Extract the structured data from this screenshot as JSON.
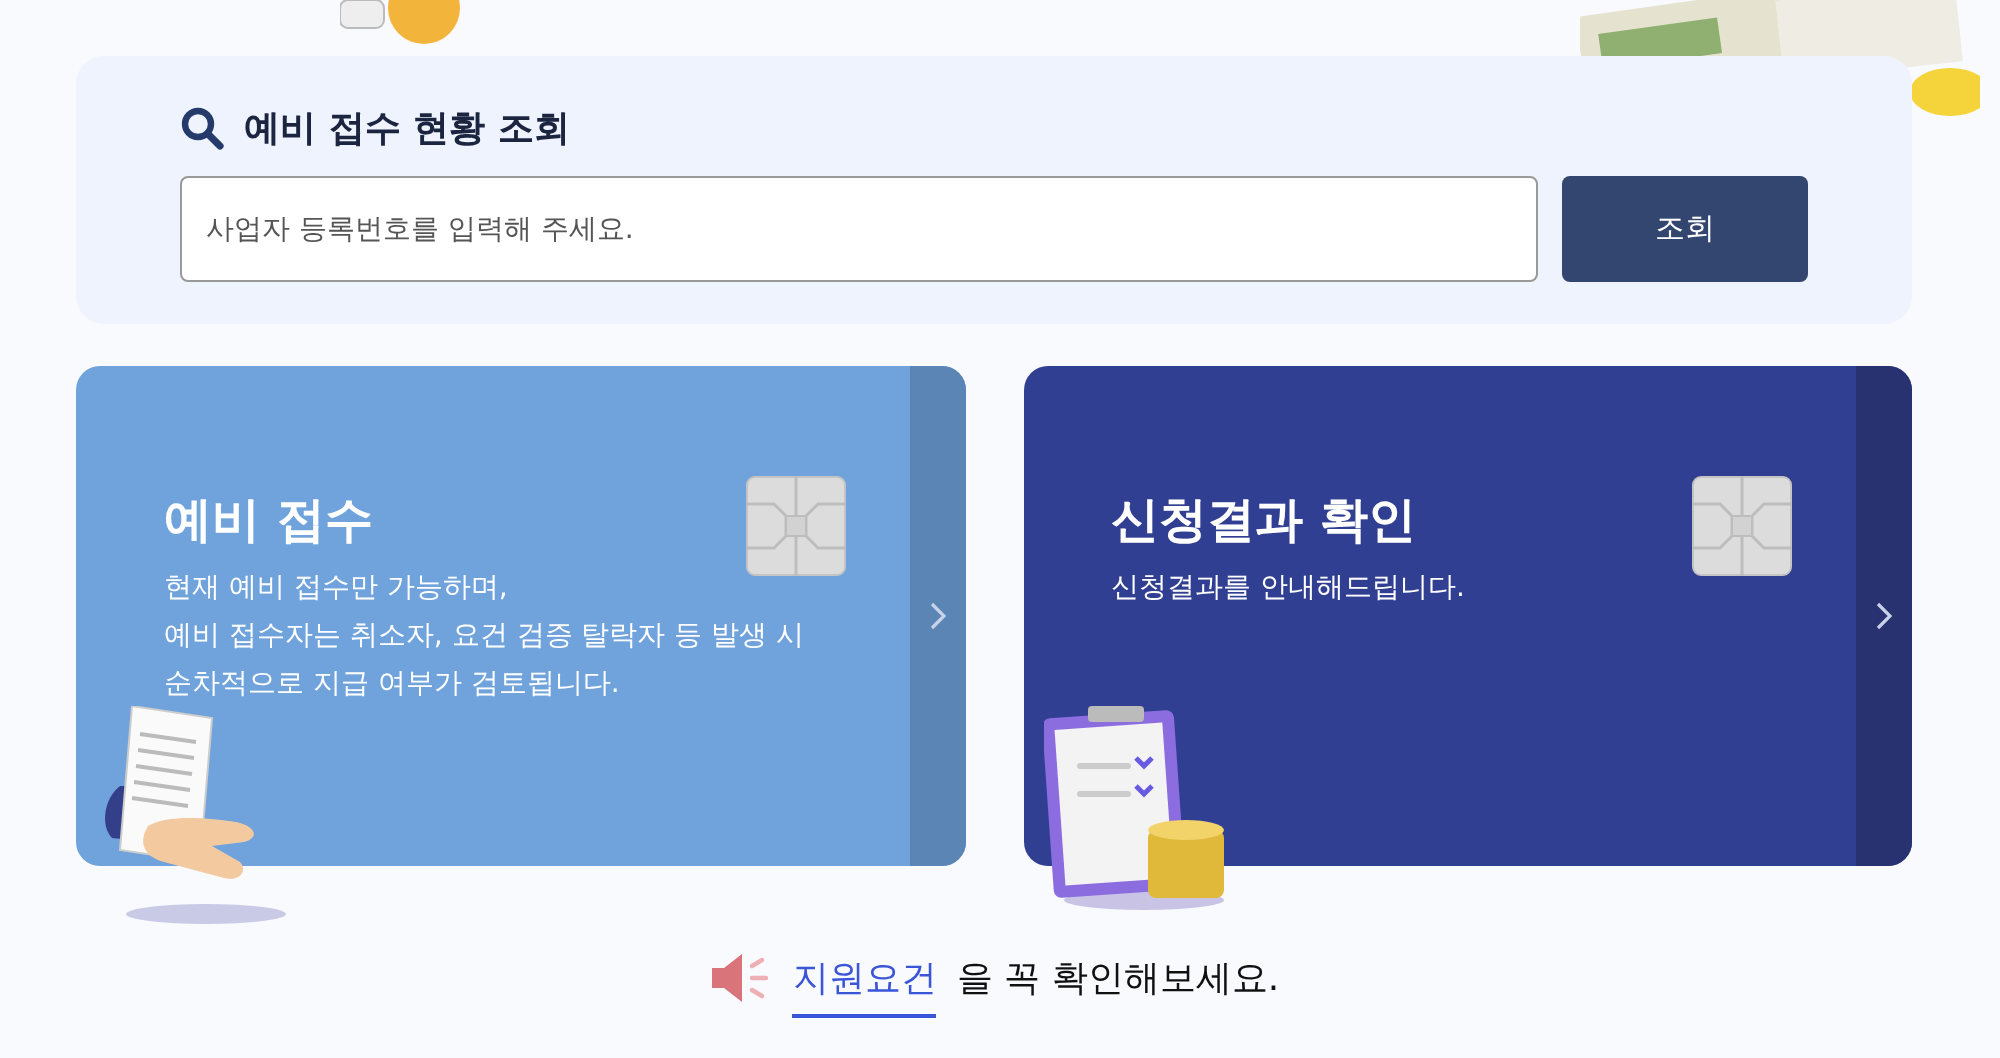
{
  "search": {
    "title": "예비 접수 현황 조회",
    "placeholder": "사업자 등록번호를 입력해 주세요.",
    "button": "조회"
  },
  "cards": [
    {
      "kind": "light",
      "title": "예비 접수",
      "description": [
        "현재 예비 접수만 가능하며,",
        "예비 접수자는 취소자, 요건 검증 탈락자 등 발생 시",
        "순차적으로 지급 여부가 검토됩니다."
      ]
    },
    {
      "kind": "dark",
      "title": "신청결과 확인",
      "description": [
        "신청결과를 안내해드립니다."
      ]
    }
  ],
  "notice": {
    "link": "지원요건",
    "text": "을 꼭 확인해보세요."
  }
}
